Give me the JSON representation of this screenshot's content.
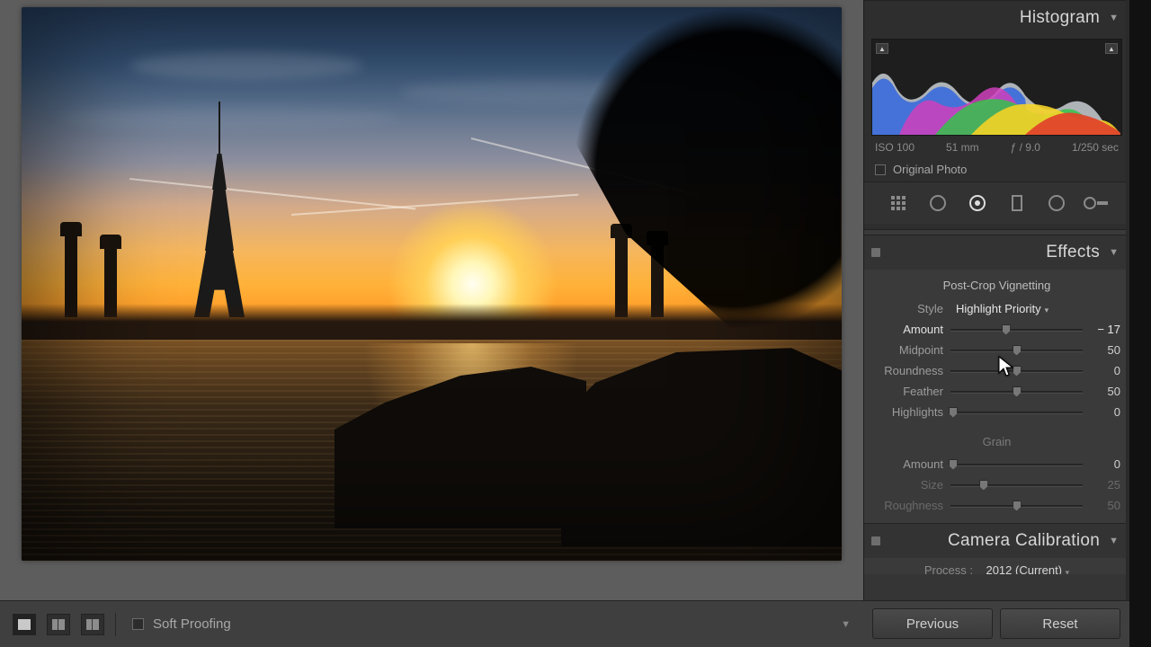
{
  "histogram": {
    "title": "Histogram",
    "meta": {
      "iso": "ISO 100",
      "focal": "51 mm",
      "aperture": "ƒ / 9.0",
      "shutter": "1/250 sec"
    },
    "original_label": "Original Photo"
  },
  "effects": {
    "title": "Effects",
    "vignette": {
      "section": "Post-Crop Vignetting",
      "style_label": "Style",
      "style_value": "Highlight Priority",
      "sliders": {
        "amount": {
          "label": "Amount",
          "value": "− 17",
          "pos": 0.42
        },
        "midpoint": {
          "label": "Midpoint",
          "value": "50",
          "pos": 0.5
        },
        "roundness": {
          "label": "Roundness",
          "value": "0",
          "pos": 0.5
        },
        "feather": {
          "label": "Feather",
          "value": "50",
          "pos": 0.5
        },
        "highlights": {
          "label": "Highlights",
          "value": "0",
          "pos": 0.02
        }
      }
    },
    "grain": {
      "section": "Grain",
      "sliders": {
        "amount": {
          "label": "Amount",
          "value": "0",
          "pos": 0.02
        },
        "size": {
          "label": "Size",
          "value": "25",
          "pos": 0.25
        },
        "roughness": {
          "label": "Roughness",
          "value": "50",
          "pos": 0.5
        }
      }
    }
  },
  "camcal": {
    "title": "Camera Calibration",
    "process_label": "Process :",
    "process_value": "2012 (Current)"
  },
  "toolbar": {
    "soft_proofing": "Soft Proofing",
    "previous": "Previous",
    "reset": "Reset"
  }
}
